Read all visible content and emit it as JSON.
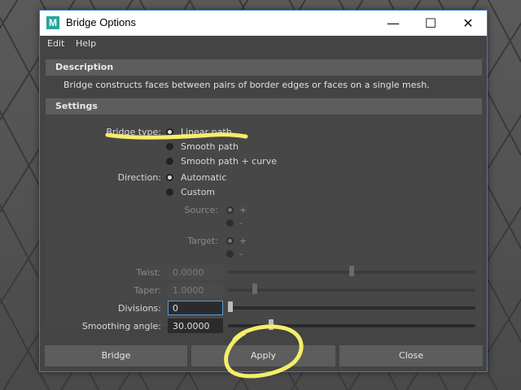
{
  "window": {
    "title": "Bridge Options",
    "app_icon": "M",
    "controls": {
      "minimize": "—",
      "maximize": "☐",
      "close": "✕"
    }
  },
  "menu": {
    "edit": "Edit",
    "help": "Help"
  },
  "description": {
    "header": "Description",
    "text": "Bridge constructs faces between pairs of border edges or faces on a single mesh."
  },
  "settings": {
    "header": "Settings",
    "bridge_type": {
      "label": "Bridge type:",
      "options": [
        "Linear path",
        "Smooth path",
        "Smooth path + curve"
      ],
      "selected": "Linear path"
    },
    "direction": {
      "label": "Direction:",
      "options": [
        "Automatic",
        "Custom"
      ],
      "selected": "Automatic"
    },
    "source": {
      "label": "Source:",
      "options": [
        "+",
        "-"
      ],
      "selected": "+"
    },
    "target": {
      "label": "Target:",
      "options": [
        "+",
        "-"
      ],
      "selected": "+"
    },
    "twist": {
      "label": "Twist:",
      "value": "0.0000",
      "slider_fraction": 0.5
    },
    "taper": {
      "label": "Taper:",
      "value": "1.0000",
      "slider_fraction": 0.1
    },
    "divisions": {
      "label": "Divisions:",
      "value": "0",
      "slider_fraction": 0.0
    },
    "smoothing_angle": {
      "label": "Smoothing angle:",
      "value": "30.0000",
      "slider_fraction": 0.167
    }
  },
  "buttons": {
    "bridge": "Bridge",
    "apply": "Apply",
    "close": "Close"
  },
  "colors": {
    "annotation": "#f5ee6a",
    "focus": "#5a9ad6",
    "window_border": "#2e7fd6"
  }
}
